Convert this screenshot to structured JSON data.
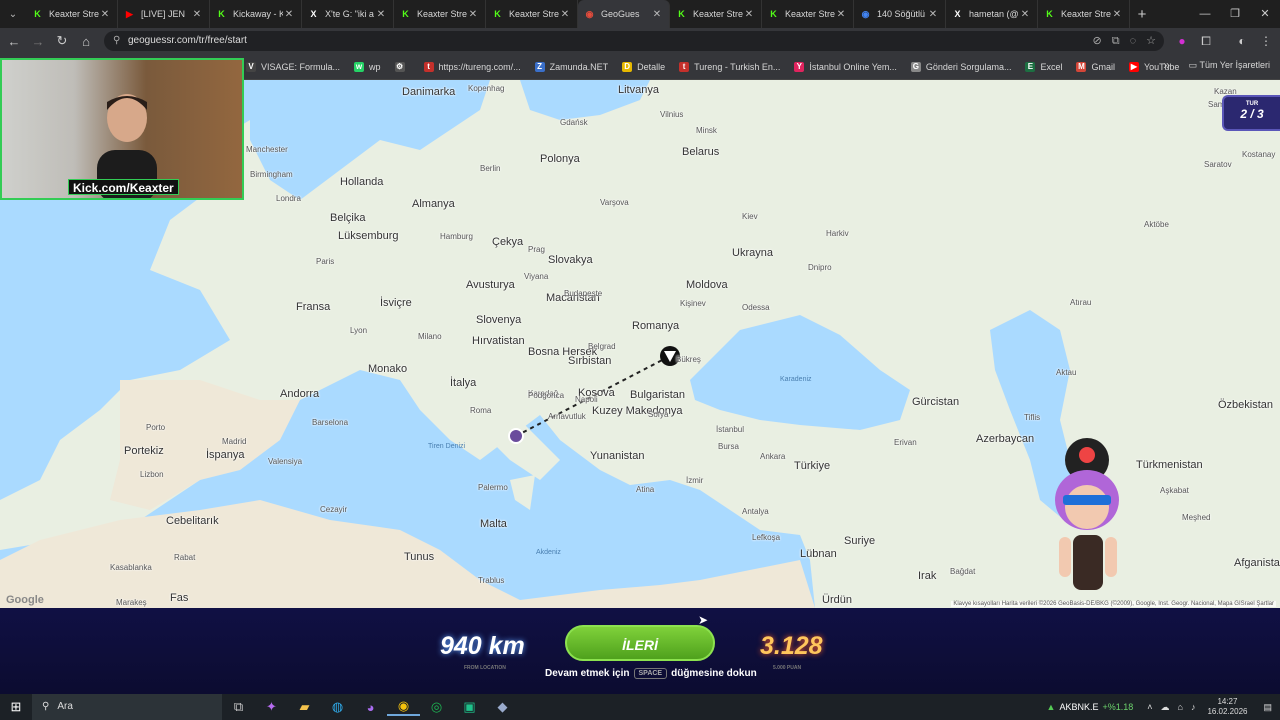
{
  "tabs": [
    {
      "title": "Keaxter Strea",
      "favicon": "K",
      "favicon_color": "#53fc18",
      "active": false
    },
    {
      "title": "[LIVE] JEN",
      "favicon": "▶",
      "favicon_color": "#ff0000",
      "active": false
    },
    {
      "title": "Kickaway - K",
      "favicon": "K",
      "favicon_color": "#53fc18",
      "active": false
    },
    {
      "title": "X'te G: \"iki a",
      "favicon": "X",
      "favicon_color": "#ffffff",
      "active": false
    },
    {
      "title": "Keaxter Strea",
      "favicon": "K",
      "favicon_color": "#53fc18",
      "active": false
    },
    {
      "title": "Keaxter Strea",
      "favicon": "K",
      "favicon_color": "#53fc18",
      "active": false
    },
    {
      "title": "GeoGues",
      "favicon": "◉",
      "favicon_color": "#e74c3c",
      "active": true
    },
    {
      "title": "Keaxter Strea",
      "favicon": "K",
      "favicon_color": "#53fc18",
      "active": false
    },
    {
      "title": "Keaxter Strea",
      "favicon": "K",
      "favicon_color": "#53fc18",
      "active": false
    },
    {
      "title": "140 Söğütlü",
      "favicon": "◉",
      "favicon_color": "#4285f4",
      "active": false
    },
    {
      "title": "hametan (@",
      "favicon": "X",
      "favicon_color": "#ffffff",
      "active": false
    },
    {
      "title": "Keaxter Strea",
      "favicon": "K",
      "favicon_color": "#53fc18",
      "active": false
    }
  ],
  "address": {
    "url": "geoguessr.com/tr/free/start"
  },
  "bookmarks": [
    {
      "label": "VISAGE: Formula...",
      "icon": "V",
      "color": "#444"
    },
    {
      "label": "wp",
      "icon": "w",
      "color": "#25d366"
    },
    {
      "label": "",
      "icon": "⚙",
      "color": "#555"
    },
    {
      "label": "https://tureng.com/...",
      "icon": "t",
      "color": "#c4302b"
    },
    {
      "label": "Zamunda.NET",
      "icon": "Z",
      "color": "#3a6fc9"
    },
    {
      "label": "Detalle",
      "icon": "D",
      "color": "#e6b800"
    },
    {
      "label": "Tureng - Turkish En...",
      "icon": "t",
      "color": "#c4302b"
    },
    {
      "label": "İstanbul Online Yem...",
      "icon": "Y",
      "color": "#e0245e"
    },
    {
      "label": "Gönderi Sorgulama...",
      "icon": "G",
      "color": "#888"
    },
    {
      "label": "Excel",
      "icon": "E",
      "color": "#1d6f42"
    },
    {
      "label": "Gmail",
      "icon": "M",
      "color": "#d44638"
    },
    {
      "label": "YouTube",
      "icon": "▶",
      "color": "#ff0000"
    }
  ],
  "bookmarks_all": "Tüm Yer İşaretleri",
  "webcam": {
    "tag": "Kick.com/Keaxter"
  },
  "round": {
    "label": "TUR",
    "value": "2 / 3"
  },
  "map": {
    "countries": [
      {
        "name": "Danimarka",
        "cls": "country"
      },
      {
        "name": "Litvanya",
        "cls": "country"
      },
      {
        "name": "Belarus",
        "cls": "country"
      },
      {
        "name": "Polonya",
        "cls": "country"
      },
      {
        "name": "Hollanda",
        "cls": "country"
      },
      {
        "name": "Almanya",
        "cls": "country"
      },
      {
        "name": "Belçika",
        "cls": "country"
      },
      {
        "name": "Lüksemburg",
        "cls": "country"
      },
      {
        "name": "Çekya",
        "cls": "country"
      },
      {
        "name": "Slovakya",
        "cls": "country"
      },
      {
        "name": "Ukrayna",
        "cls": "country"
      },
      {
        "name": "Avusturya",
        "cls": "country"
      },
      {
        "name": "Macaristan",
        "cls": "country"
      },
      {
        "name": "Moldova",
        "cls": "country"
      },
      {
        "name": "Fransa",
        "cls": "country"
      },
      {
        "name": "İsviçre",
        "cls": "country"
      },
      {
        "name": "Slovenya",
        "cls": "country"
      },
      {
        "name": "Hırvatistan",
        "cls": "country"
      },
      {
        "name": "Romanya",
        "cls": "country"
      },
      {
        "name": "Bosna Hersek",
        "cls": "country"
      },
      {
        "name": "Sırbistan",
        "cls": "country"
      },
      {
        "name": "Monako",
        "cls": "country"
      },
      {
        "name": "Andorra",
        "cls": "country"
      },
      {
        "name": "İtalya",
        "cls": "country"
      },
      {
        "name": "Kosova",
        "cls": "country"
      },
      {
        "name": "Bulgaristan",
        "cls": "country"
      },
      {
        "name": "Kuzey Makedonya",
        "cls": "country"
      },
      {
        "name": "Gürcistan",
        "cls": "country"
      },
      {
        "name": "Portekiz",
        "cls": "country"
      },
      {
        "name": "İspanya",
        "cls": "country"
      },
      {
        "name": "Yunanistan",
        "cls": "country"
      },
      {
        "name": "Türkiye",
        "cls": "country"
      },
      {
        "name": "Azerbaycan",
        "cls": "country"
      },
      {
        "name": "Özbekistan",
        "cls": "country"
      },
      {
        "name": "Türkmenistan",
        "cls": "country"
      },
      {
        "name": "Malta",
        "cls": "country"
      },
      {
        "name": "Tunus",
        "cls": "country"
      },
      {
        "name": "Suriye",
        "cls": "country"
      },
      {
        "name": "Lübnan",
        "cls": "country"
      },
      {
        "name": "Irak",
        "cls": "country"
      },
      {
        "name": "Ürdün",
        "cls": "country"
      },
      {
        "name": "Afganista",
        "cls": "country"
      },
      {
        "name": "Cebelitarık",
        "cls": "country"
      },
      {
        "name": "Fas",
        "cls": "country"
      },
      {
        "name": "Arnavutluk",
        "cls": "small"
      },
      {
        "name": "Karadağ",
        "cls": "small"
      }
    ],
    "cities": [
      "Kopenhag",
      "Gdańsk",
      "Vilnius",
      "Minsk",
      "Manchester",
      "Birmingham",
      "Londra",
      "Berlin",
      "Varşova",
      "Hamburg",
      "Prag",
      "Kiev",
      "Harkiv",
      "Dnipro",
      "Paris",
      "Viyana",
      "Budapeşte",
      "Kişinev",
      "Odessa",
      "Lyon",
      "Milano",
      "Belgrad",
      "Bükreş",
      "Roma",
      "Podgorica",
      "Napoli",
      "Sofya",
      "İstanbul",
      "Bursa",
      "Ankara",
      "İzmir",
      "Atina",
      "Antalya",
      "Lefkoşa",
      "Palermo",
      "Madrid",
      "Barselona",
      "Valensiya",
      "Porto",
      "Lizbon",
      "Cezayir",
      "Trablus",
      "Rabat",
      "Kasablanka",
      "Marakeş",
      "Erivan",
      "Tiflis",
      "Aşkabat",
      "Meşhed",
      "Bağdat",
      "Aktau",
      "Aktöbe",
      "Samara",
      "Kazan",
      "Saratov",
      "Atırau",
      "Kostanay"
    ],
    "seas": [
      "Karadeniz",
      "Tiren Denizi",
      "Akdeniz"
    ],
    "google": "Google",
    "attribution": "Klavye kısayolları   Harita verileri ©2026 GeoBasis-DE/BKG (©2009), Google, Inst. Geogr. Nacional, Mapa GISrael   Şartlar"
  },
  "result": {
    "distance": "940 km",
    "distance_sub": "FROM LOCATION",
    "next_label": "İLERİ",
    "hint_pre": "Devam etmek için",
    "hint_key": "SPACE",
    "hint_post": "düğmesine dokun",
    "points": "3.128",
    "points_sub": "5.000 PUAN"
  },
  "taskbar": {
    "search_label": "Ara",
    "stock_name": "AKBNK.E",
    "stock_change": "+%1.18",
    "time": "14:27",
    "date": "16.02.2026"
  }
}
